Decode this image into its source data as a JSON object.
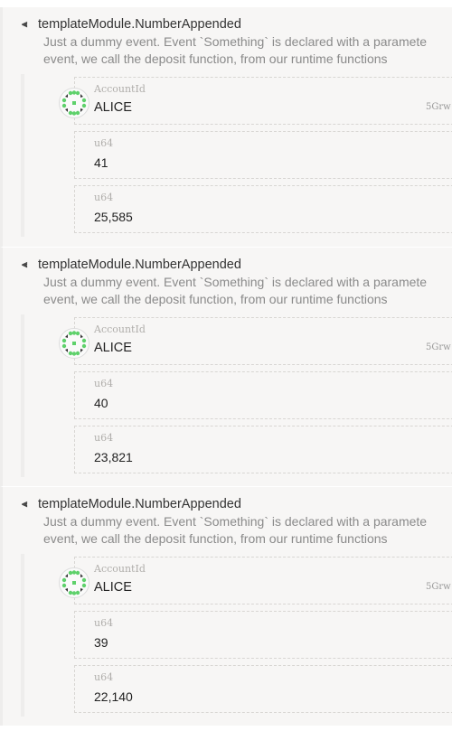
{
  "events": [
    {
      "title": "templateModule.NumberAppended",
      "description": [
        "Just a dummy event. Event `Something` is declared with a paramete",
        "event, we call the deposit function, from our runtime functions"
      ],
      "account": {
        "type": "AccountId",
        "name": "ALICE",
        "address": "5Grw"
      },
      "params": [
        {
          "type": "u64",
          "value": "41"
        },
        {
          "type": "u64",
          "value": "25,585"
        }
      ]
    },
    {
      "title": "templateModule.NumberAppended",
      "description": [
        "Just a dummy event. Event `Something` is declared with a paramete",
        "event, we call the deposit function, from our runtime functions"
      ],
      "account": {
        "type": "AccountId",
        "name": "ALICE",
        "address": "5Grw"
      },
      "params": [
        {
          "type": "u64",
          "value": "40"
        },
        {
          "type": "u64",
          "value": "23,821"
        }
      ]
    },
    {
      "title": "templateModule.NumberAppended",
      "description": [
        "Just a dummy event. Event `Something` is declared with a paramete",
        "event, we call the deposit function, from our runtime functions"
      ],
      "account": {
        "type": "AccountId",
        "name": "ALICE",
        "address": "5Grw"
      },
      "params": [
        {
          "type": "u64",
          "value": "39"
        },
        {
          "type": "u64",
          "value": "22,140"
        }
      ]
    }
  ],
  "icons": {
    "expand": "chevron-double-down-icon",
    "avatar": "identicon"
  },
  "colors": {
    "identicon_green": "#5ed16b"
  }
}
